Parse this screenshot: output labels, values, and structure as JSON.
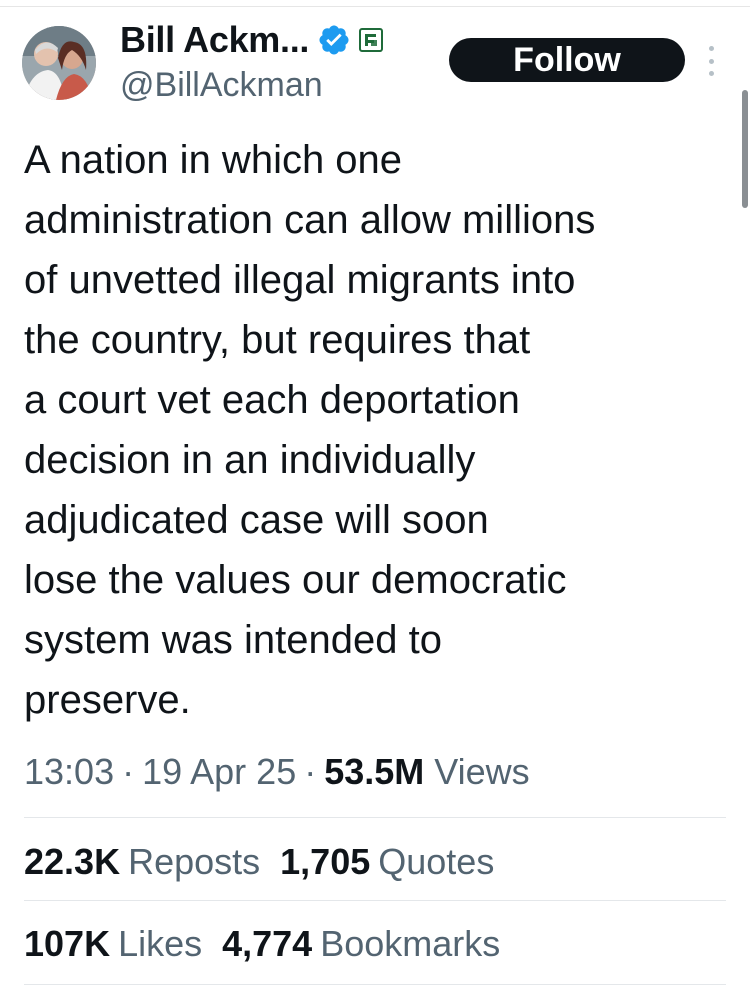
{
  "author": {
    "display_name": "Bill Ackm...",
    "handle": "@BillAckman",
    "avatar_icon": "avatar-photo",
    "verified_icon": "verified-badge-icon",
    "affiliate_icon": "affiliate-badge-icon"
  },
  "actions": {
    "follow_label": "Follow",
    "more_icon": "more-vertical-icon"
  },
  "tweet": {
    "lines": [
      "A nation in which one",
      "administration can allow millions",
      "of unvetted illegal migrants into",
      "the country, but requires that",
      "a court vet each deportation",
      "decision in an individually",
      "adjudicated case will soon",
      "lose the values our democratic",
      "system was intended to",
      "preserve."
    ]
  },
  "meta": {
    "time": "13:03",
    "separator": "·",
    "date": "19 Apr 25",
    "views_count": "53.5M",
    "views_label": "Views"
  },
  "stats": {
    "reposts_count": "22.3K",
    "reposts_label": "Reposts",
    "quotes_count": "1,705",
    "quotes_label": "Quotes",
    "likes_count": "107K",
    "likes_label": "Likes",
    "bookmarks_count": "4,774",
    "bookmarks_label": "Bookmarks"
  },
  "colors": {
    "text_primary": "#0f1419",
    "text_secondary": "#536471",
    "verified_blue": "#1d9bf0",
    "affiliate_green": "#1f6b3a",
    "divider": "#e4e7ea"
  }
}
